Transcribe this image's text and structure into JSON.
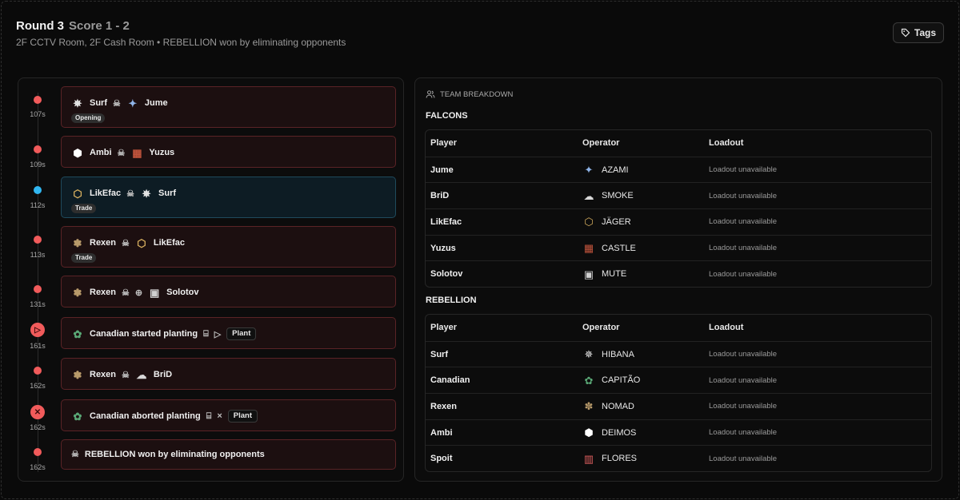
{
  "header": {
    "round": "Round 3",
    "score": "Score 1 - 2",
    "subtitle": "2F CCTV Room, 2F Cash Room • REBELLION won by eliminating opponents",
    "tags_label": "Tags"
  },
  "timeline": [
    {
      "time": "107s",
      "actor": "Surf",
      "target": "Jume",
      "chip": "Opening"
    },
    {
      "time": "109s",
      "actor": "Ambi",
      "target": "Yuzus"
    },
    {
      "time": "112s",
      "actor": "LikEfac",
      "target": "Surf",
      "chip": "Trade"
    },
    {
      "time": "113s",
      "actor": "Rexen",
      "target": "LikEfac",
      "chip": "Trade"
    },
    {
      "time": "131s",
      "actor": "Rexen",
      "target": "Solotov"
    },
    {
      "time": "161s",
      "text": "Canadian started planting",
      "pill": "Plant"
    },
    {
      "time": "162s",
      "actor": "Rexen",
      "target": "BriD"
    },
    {
      "time": "162s",
      "text": "Canadian aborted planting",
      "pill": "Plant"
    },
    {
      "time": "162s",
      "text": "REBELLION won by eliminating opponents"
    }
  ],
  "breakdown": {
    "title": "TEAM BREAKDOWN",
    "columns": [
      "Player",
      "Operator",
      "Loadout"
    ],
    "teams": [
      {
        "name": "FALCONS",
        "rows": [
          {
            "player": "Jume",
            "operator": "AZAMI",
            "loadout": "Loadout unavailable"
          },
          {
            "player": "BriD",
            "operator": "SMOKE",
            "loadout": "Loadout unavailable"
          },
          {
            "player": "LikEfac",
            "operator": "JÄGER",
            "loadout": "Loadout unavailable"
          },
          {
            "player": "Yuzus",
            "operator": "CASTLE",
            "loadout": "Loadout unavailable"
          },
          {
            "player": "Solotov",
            "operator": "MUTE",
            "loadout": "Loadout unavailable"
          }
        ]
      },
      {
        "name": "REBELLION",
        "rows": [
          {
            "player": "Surf",
            "operator": "HIBANA",
            "loadout": "Loadout unavailable"
          },
          {
            "player": "Canadian",
            "operator": "CAPITÃO",
            "loadout": "Loadout unavailable"
          },
          {
            "player": "Rexen",
            "operator": "NOMAD",
            "loadout": "Loadout unavailable"
          },
          {
            "player": "Ambi",
            "operator": "DEIMOS",
            "loadout": "Loadout unavailable"
          },
          {
            "player": "Spoit",
            "operator": "FLORES",
            "loadout": "Loadout unavailable"
          }
        ]
      }
    ]
  },
  "colors": {
    "red": "#f15b5b",
    "blue": "#31b7f1",
    "card_red": "#1c0f10",
    "card_blue": "#0d1c24"
  }
}
